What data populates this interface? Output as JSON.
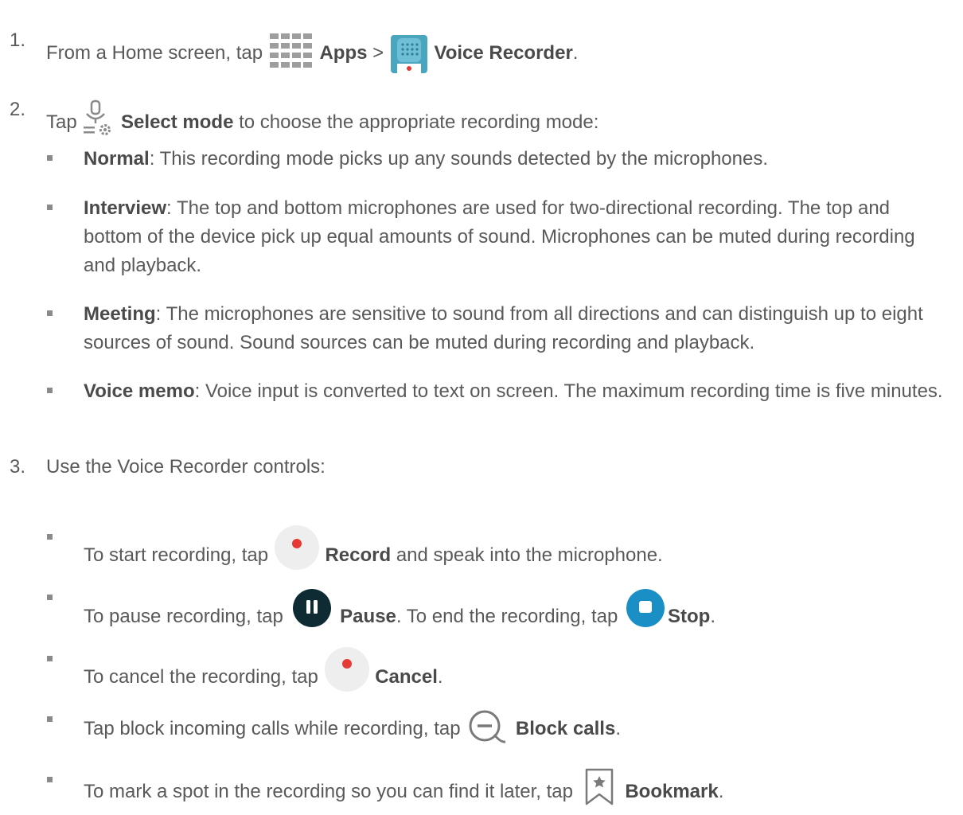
{
  "step1": {
    "number": "1.",
    "prefix": "From a Home screen, tap",
    "apps_label": "Apps",
    "separator": ">",
    "voice_recorder_label": "Voice Recorder",
    "end": "."
  },
  "step2": {
    "number": "2.",
    "prefix": "Tap",
    "select_mode_label": "Select mode",
    "suffix": "to choose the appropriate recording mode:"
  },
  "modes": [
    {
      "name": "Normal",
      "desc": ": This recording mode picks up any sounds detected by the microphones."
    },
    {
      "name": "Interview",
      "desc": ": The top and bottom microphones are used for two-directional recording. The top and bottom of the device pick up equal amounts of sound. Microphones can be muted during recording and playback."
    },
    {
      "name": "Meeting",
      "desc": ": The microphones are sensitive to sound from all directions and can distinguish up to eight sources of sound. Sound sources can be muted during recording and playback."
    },
    {
      "name": "Voice memo",
      "desc": ": Voice input is converted to text on screen. The maximum recording time is five minutes."
    }
  ],
  "step3": {
    "number": "3.",
    "text": "Use the Voice Recorder controls:"
  },
  "controls": {
    "record": {
      "prefix": "To start recording, tap",
      "label": "Record",
      "suffix": "and speak into the microphone."
    },
    "pause": {
      "prefix": "To pause recording, tap",
      "label": "Pause",
      "middle": ". To end the recording, tap",
      "stop_label": "Stop",
      "end": "."
    },
    "cancel": {
      "prefix": "To cancel the recording, tap",
      "label": "Cancel",
      "end": "."
    },
    "block": {
      "prefix": "Tap block incoming calls while recording, tap",
      "label": "Block calls",
      "end": "."
    },
    "bookmark": {
      "prefix": "To mark a spot in the recording so you can find it later, tap",
      "label": "Bookmark",
      "end": "."
    }
  },
  "colors": {
    "text": "#595959",
    "record_red": "#e53935",
    "pause_dark": "#0e2a33",
    "stop_blue": "#1a8fc6",
    "recorder_teal": "#4aa6bf"
  },
  "icons": [
    "apps-grid-icon",
    "voice-recorder-app-icon",
    "select-mode-icon",
    "record-icon",
    "pause-icon",
    "stop-icon",
    "cancel-icon",
    "block-calls-icon",
    "bookmark-icon"
  ]
}
